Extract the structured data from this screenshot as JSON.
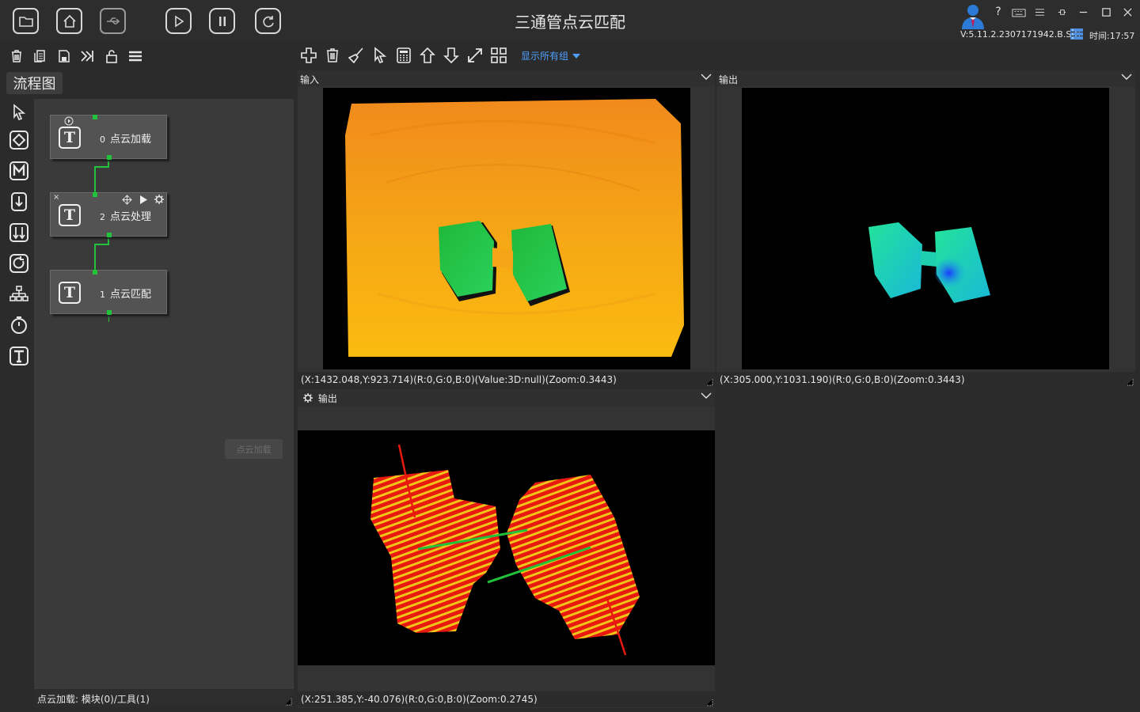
{
  "app": {
    "title": "三通管点云匹配",
    "version": "V:5.11.2.2307171942.B.S.C",
    "time_label": "时间:17:57"
  },
  "titlebar": {
    "buttons": [
      "open-folder-icon",
      "home-icon",
      "usb-icon",
      "play-icon",
      "pause-icon",
      "refresh-icon"
    ],
    "window_controls": [
      "help-icon",
      "keyboard-icon",
      "menu-icon",
      "pin-icon",
      "minimize-icon",
      "maximize-icon",
      "close-icon"
    ]
  },
  "left_toolbar": {
    "buttons": [
      "delete-icon",
      "copy-icon",
      "save-icon",
      "import-icon",
      "unlock-icon",
      "list-icon"
    ]
  },
  "flow": {
    "tab_label": "流程图",
    "nodes": [
      {
        "num": "0",
        "label": "点云加载"
      },
      {
        "num": "2",
        "label": "点云处理"
      },
      {
        "num": "1",
        "label": "点云匹配"
      }
    ],
    "ghost_label": "点云加载"
  },
  "side_tools": [
    "pointer-icon",
    "diamond-icon",
    "m-module-icon",
    "down-arrow-icon",
    "parallel-icon",
    "loop-icon",
    "tree-icon",
    "timer-icon",
    "text-tool-icon"
  ],
  "left_status": "点云加载: 模块(0)/工具(1)",
  "main_toolbar": {
    "buttons": [
      "add-icon",
      "trash-icon",
      "brush-icon",
      "select-icon",
      "calculator-icon",
      "up-arrow-icon",
      "down-icon",
      "expand-icon",
      "grid-icon"
    ],
    "group_select": "显示所有组"
  },
  "views": {
    "input": {
      "title": "输入",
      "status": "(X:1432.048,Y:923.714)(R:0,G:0,B:0)(Value:3D:null)(Zoom:0.3443)"
    },
    "output": {
      "title": "输出",
      "status": "(X:305.000,Y:1031.190)(R:0,G:0,B:0)(Zoom:0.3443)"
    },
    "output3d": {
      "title": "输出",
      "status": "(X:251.385,Y:-40.076)(R:0,G:0,B:0)(Zoom:0.2745)"
    }
  },
  "colors": {
    "accent_blue": "#4fa0ff",
    "wire_green": "#22c33a",
    "background": "#2b2b2b"
  }
}
